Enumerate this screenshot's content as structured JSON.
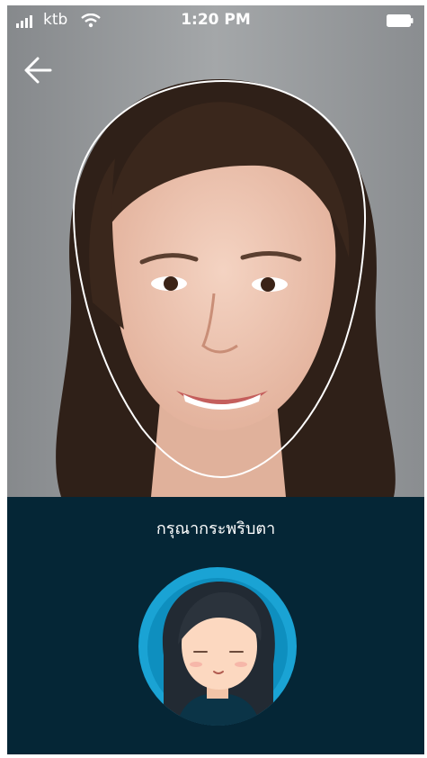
{
  "status_bar": {
    "carrier": "ktb",
    "time": "1:20 PM",
    "icons": [
      "signal-icon",
      "wifi-icon",
      "battery-icon"
    ]
  },
  "navigation": {
    "back_icon": "arrow-left-icon"
  },
  "camera": {
    "face_guide": "oval-face-outline"
  },
  "instruction": {
    "text": "กรุณากระพริบตา"
  },
  "illustration": {
    "name": "blinking-girl-avatar"
  },
  "colors": {
    "panel_bg": "#052636",
    "avatar_ring": "#1aa3d4",
    "camera_bg": "#8f9497"
  }
}
